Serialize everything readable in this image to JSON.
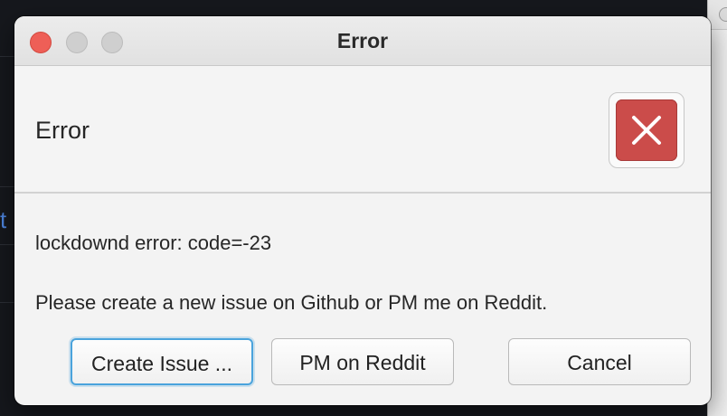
{
  "window": {
    "title": "Error"
  },
  "dialog": {
    "header": "Error",
    "icon": "error-x-icon",
    "message_line1": "lockdownd error: code=-23",
    "message_line2": "Please create a new issue on Github or PM me on Reddit."
  },
  "buttons": {
    "create_issue": "Create Issue ...",
    "pm_reddit": "PM on Reddit",
    "cancel": "Cancel"
  },
  "colors": {
    "error_red": "#cb4c4a",
    "focus_blue": "#4aa3dc",
    "close_traffic": "#ee5f57"
  }
}
